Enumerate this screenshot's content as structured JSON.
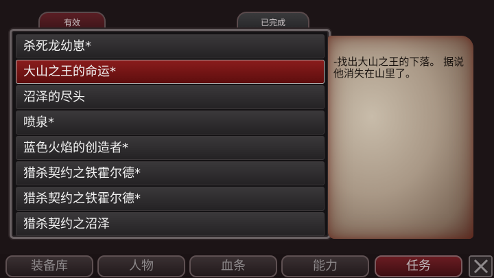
{
  "tabs": {
    "active_label": "有效",
    "completed_label": "已完成"
  },
  "quests": [
    {
      "label": "杀死龙幼崽*",
      "selected": false
    },
    {
      "label": "大山之王的命运*",
      "selected": true
    },
    {
      "label": "沼泽的尽头",
      "selected": false
    },
    {
      "label": "喷泉*",
      "selected": false
    },
    {
      "label": "蓝色火焰的创造者*",
      "selected": false
    },
    {
      "label": "猎杀契约之铁霍尔德*",
      "selected": false
    },
    {
      "label": "猎杀契约之铁霍尔德*",
      "selected": false
    },
    {
      "label": "猎杀契约之沼泽",
      "selected": false
    }
  ],
  "description": "-找出大山之王的下落。 据说他消失在山里了。",
  "menu": {
    "equipment": "装备库",
    "character": "人物",
    "health": "血条",
    "abilities": "能力",
    "quests": "任务"
  },
  "close_icon": "close-x-icon"
}
